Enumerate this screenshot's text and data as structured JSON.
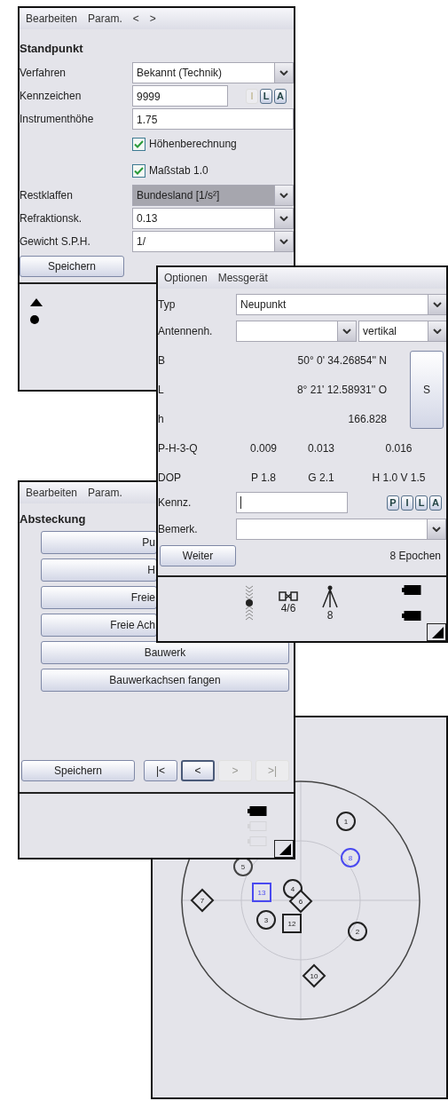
{
  "standpunkt_window": {
    "menu": [
      "Bearbeiten",
      "Param.",
      "<",
      ">"
    ],
    "title": "Standpunkt",
    "rows": [
      {
        "kind": "select",
        "label": "Verfahren",
        "value": "Bekannt (Technik)",
        "focused": false
      },
      {
        "kind": "input",
        "label": "Kennzeichen",
        "value": "9999",
        "buttons": [
          {
            "label": "I",
            "disabled": true
          },
          {
            "label": "L",
            "disabled": false
          },
          {
            "label": "A",
            "disabled": false
          }
        ]
      },
      {
        "kind": "input",
        "label": "Instrumenthöhe",
        "value": "1.75"
      },
      {
        "kind": "checkbox",
        "label": "Höhenberechnung",
        "checked": true
      },
      {
        "kind": "checkbox",
        "label": "Maßstab 1.0",
        "checked": true
      },
      {
        "kind": "select",
        "label": "Restklaffen",
        "value": "Bundesland [1/s²]",
        "focused": true
      },
      {
        "kind": "select",
        "label": "Refraktionsk.",
        "value": "0.13",
        "focused": false
      },
      {
        "kind": "select",
        "label": "Gewicht S.P.H.",
        "value": "1/",
        "focused": false
      }
    ],
    "save_button": "Speichern"
  },
  "gnss_window": {
    "menu": [
      "Optionen",
      "Messgerät"
    ],
    "typ": {
      "label": "Typ",
      "value": "Neupunkt"
    },
    "antenna": {
      "label": "Antennenh.",
      "mode": "vertikal"
    },
    "coordinates": [
      {
        "label": "B",
        "value": "50° 0' 34.26854'' N"
      },
      {
        "label": "L",
        "value": "8° 21' 12.58931'' O"
      },
      {
        "label": "h",
        "value": "166.828"
      }
    ],
    "side_button": "S",
    "stats": [
      {
        "label": "P-H-3-Q",
        "values": [
          "0.009",
          "0.013",
          "0.016"
        ]
      },
      {
        "label": "DOP",
        "values": [
          "P 1.8",
          "G 2.1",
          "H 1.0 V 1.5"
        ]
      }
    ],
    "kennz": {
      "label": "Kennz.",
      "buttons": [
        {
          "label": "P",
          "disabled": false
        },
        {
          "label": "I",
          "disabled": false
        },
        {
          "label": "L",
          "disabled": false
        },
        {
          "label": "A",
          "disabled": false
        }
      ]
    },
    "bemerk": {
      "label": "Bemerk."
    },
    "next_button": "Weiter",
    "epochs": "8 Epochen",
    "satellites_used": "4/6",
    "stations": "8"
  },
  "absteckung_window": {
    "menu": [
      "Bearbeiten",
      "Param."
    ],
    "title": "Absteckung",
    "buttons": [
      {
        "label": "Pu",
        "covered": true
      },
      {
        "label": "H",
        "covered": true
      },
      {
        "label": "Freie",
        "covered": true
      },
      {
        "label": "Freie Ach",
        "covered": true
      },
      {
        "label": "Bauwerk",
        "covered": false
      },
      {
        "label": "Bauwerkachsen fangen",
        "covered": false
      }
    ],
    "save_button": "Speichern",
    "nav": [
      {
        "label": "|<",
        "disabled": false,
        "focused": false
      },
      {
        "label": "<",
        "disabled": false,
        "focused": true
      },
      {
        "label": ">",
        "disabled": true,
        "focused": false
      },
      {
        "label": ">|",
        "disabled": true,
        "focused": false
      }
    ]
  },
  "skyplot_window": {
    "satellites": [
      {
        "label": "1",
        "kind": "circle",
        "color": "#222222"
      },
      {
        "label": "8",
        "kind": "circle",
        "color": "#4a4af0"
      },
      {
        "label": "5",
        "kind": "circle",
        "color": "#444444"
      },
      {
        "label": "4",
        "kind": "circle",
        "color": "#222222"
      },
      {
        "label": "13",
        "kind": "square",
        "color": "#4a4af0"
      },
      {
        "label": "7",
        "kind": "diamond",
        "color": "#222222"
      },
      {
        "label": "6",
        "kind": "diamond",
        "color": "#222222"
      },
      {
        "label": "3",
        "kind": "circle",
        "color": "#222222"
      },
      {
        "label": "12",
        "kind": "square",
        "color": "#222222"
      },
      {
        "label": "2",
        "kind": "circle",
        "color": "#222222"
      },
      {
        "label": "10",
        "kind": "diamond",
        "color": "#222222"
      }
    ]
  }
}
